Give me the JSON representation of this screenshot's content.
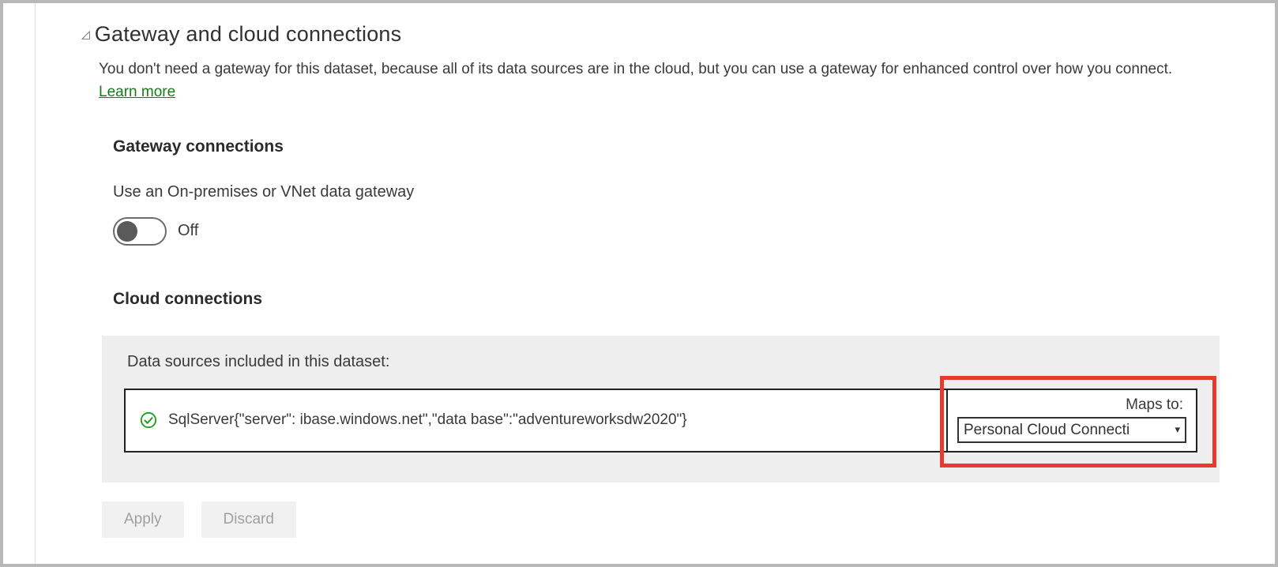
{
  "section": {
    "title": "Gateway and cloud connections",
    "description_prefix": "You don't need a gateway for this dataset, because all of its data sources are in the cloud, but you can use a gateway for enhanced control over how you connect. ",
    "learn_more": "Learn more"
  },
  "gateway": {
    "heading": "Gateway connections",
    "label": "Use an On-premises or VNet data gateway",
    "toggle_state": "Off"
  },
  "cloud": {
    "heading": "Cloud connections",
    "box_label": "Data sources included in this dataset:",
    "data_source_text": "SqlServer{\"server\":                                    ibase.windows.net\",\"data base\":\"adventureworksdw2020\"}",
    "maps_to_label": "Maps to:",
    "maps_to_selected": "Personal Cloud Connecti"
  },
  "footer": {
    "apply": "Apply",
    "discard": "Discard"
  }
}
